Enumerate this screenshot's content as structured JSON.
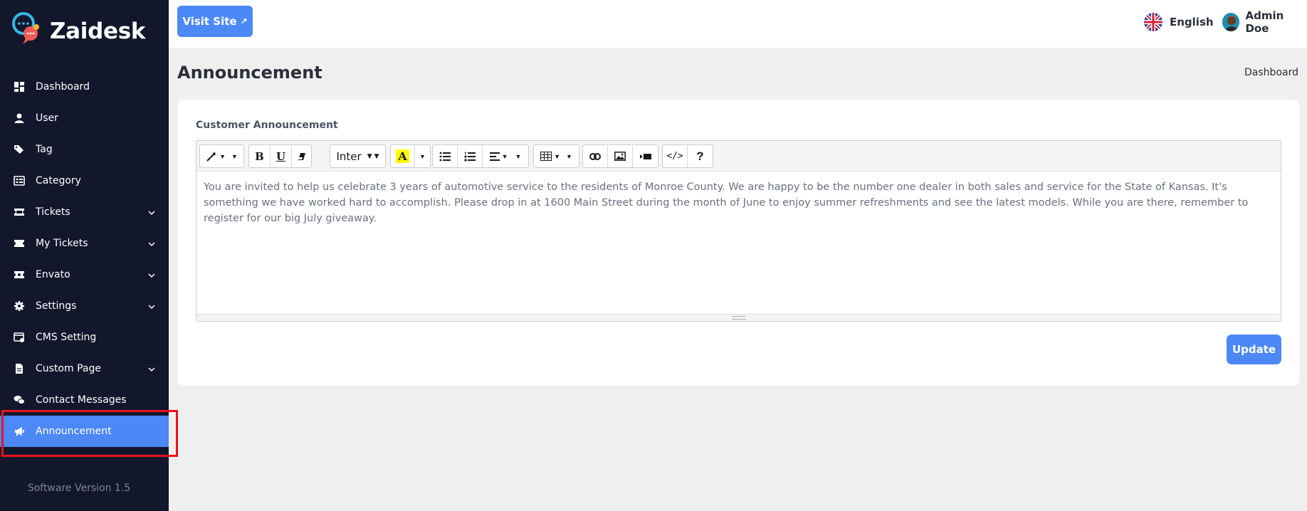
{
  "brand": {
    "name": "Zaidesk",
    "logo_icon": "chat-bubbles-logo-icon"
  },
  "sidebar": {
    "items": [
      {
        "label": "Dashboard",
        "icon": "dashboard-icon",
        "has_children": false
      },
      {
        "label": "User",
        "icon": "user-icon",
        "has_children": false
      },
      {
        "label": "Tag",
        "icon": "tags-icon",
        "has_children": false
      },
      {
        "label": "Category",
        "icon": "category-icon",
        "has_children": false
      },
      {
        "label": "Tickets",
        "icon": "ticket-icon",
        "has_children": true
      },
      {
        "label": "My Tickets",
        "icon": "ticket-icon",
        "has_children": true
      },
      {
        "label": "Envato",
        "icon": "envato-ticket-icon",
        "has_children": true
      },
      {
        "label": "Settings",
        "icon": "gear-icon",
        "has_children": true
      },
      {
        "label": "CMS Setting",
        "icon": "cms-window-icon",
        "has_children": false
      },
      {
        "label": "Custom Page",
        "icon": "file-icon",
        "has_children": true
      },
      {
        "label": "Contact Messages",
        "icon": "chat-icon",
        "has_children": false
      },
      {
        "label": "Announcement",
        "icon": "megaphone-icon",
        "has_children": false,
        "active": true
      }
    ],
    "version": "Software Version 1.5"
  },
  "topbar": {
    "visit_label": "Visit Site",
    "visit_icon": "external-arrow-icon",
    "language": "English",
    "language_icon": "uk-flag-icon",
    "user_name": "Admin Doe"
  },
  "page": {
    "title": "Announcement",
    "breadcrumb": "Dashboard"
  },
  "form": {
    "field_label": "Customer Announcement",
    "editor": {
      "font": "Inter",
      "content": "You are invited to help us celebrate 3 years of automotive service to the residents of Monroe County. We are happy to be the number one dealer in both sales and service for the State of Kansas. It's something we have worked hard to accomplish. Please drop in at 1600 Main Street during the month of June to enjoy summer refreshments and see the latest models. While you are there, remember to register for our big July giveaway."
    },
    "toolbar": {
      "bold": "B",
      "underline": "U",
      "highlight": "A",
      "code": "</>",
      "help": "?"
    },
    "update_label": "Update"
  },
  "colors": {
    "sidebar_bg": "#13172b",
    "accent": "#4c88f6",
    "highlight_box": "#e8141c"
  }
}
